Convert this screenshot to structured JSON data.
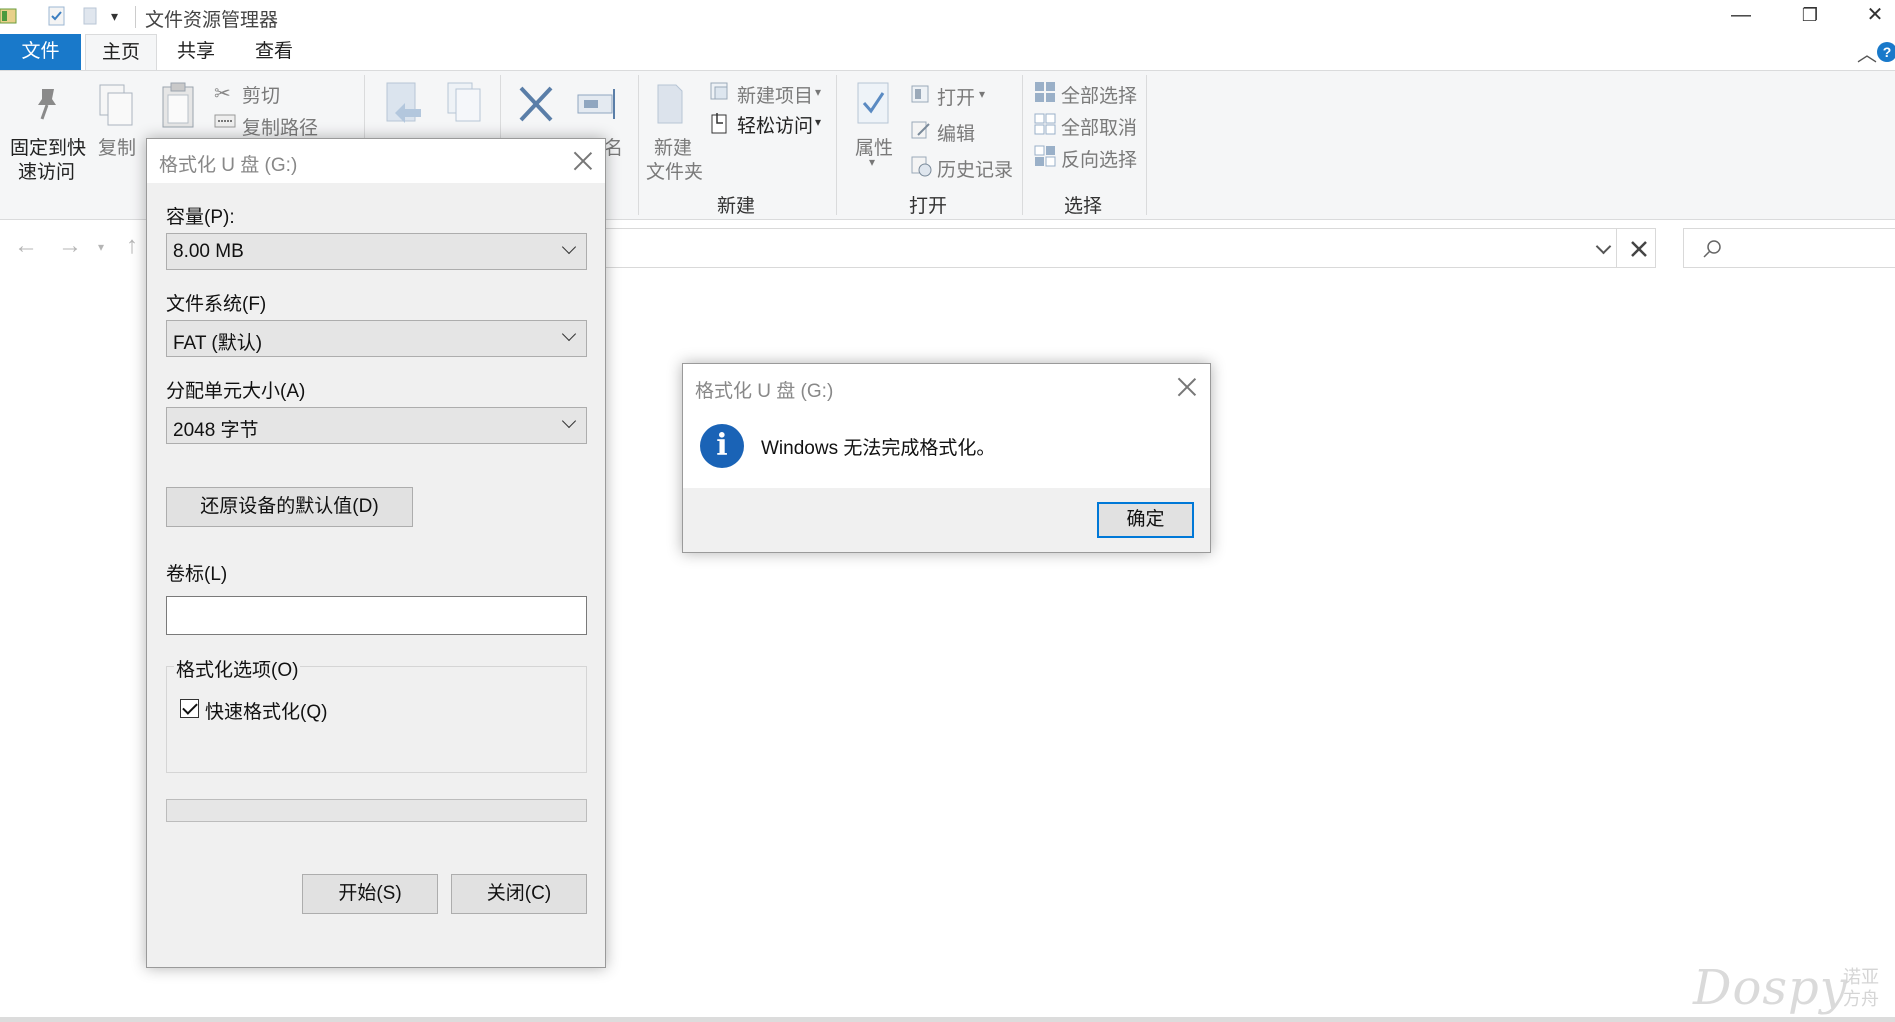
{
  "window": {
    "title": "文件资源管理器",
    "minimize_glyph": "—",
    "restore_glyph": "❐",
    "close_glyph": "✕"
  },
  "tabs": [
    {
      "label": "文件"
    },
    {
      "label": "主页"
    },
    {
      "label": "共享"
    },
    {
      "label": "查看"
    }
  ],
  "ribbon": {
    "pin_label_1": "固定到快",
    "pin_label_2": "速访问",
    "copy_label": "复制",
    "cut_label": "剪切",
    "copy_path_label": "复制路径",
    "rename_fragment": "名",
    "new_folder_label_1": "新建",
    "new_folder_label_2": "文件夹",
    "new_item_label": "新建项目",
    "easy_access_label": "轻松访问",
    "properties_label": "属性",
    "open_label": "打开",
    "edit_label": "编辑",
    "history_label": "历史记录",
    "select_all_label": "全部选择",
    "select_none_label": "全部取消",
    "invert_selection_label": "反向选择",
    "group_new": "新建",
    "group_open": "打开",
    "group_select": "选择"
  },
  "format_dialog": {
    "title": "格式化 U 盘 (G:)",
    "capacity_label": "容量(P):",
    "capacity_value": "8.00 MB",
    "filesystem_label": "文件系统(F)",
    "filesystem_value": "FAT (默认)",
    "allocation_label": "分配单元大小(A)",
    "allocation_value": "2048 字节",
    "restore_defaults_button": "还原设备的默认值(D)",
    "volume_label": "卷标(L)",
    "volume_value": "",
    "options_group_label": "格式化选项(O)",
    "quick_format_label": "快速格式化(Q)",
    "quick_format_checked": true,
    "progress": 0,
    "start_button": "开始(S)",
    "close_button": "关闭(C)"
  },
  "message_box": {
    "title": "格式化 U 盘 (G:)",
    "message": "Windows 无法完成格式化。",
    "icon": "info-icon",
    "ok_button": "确定"
  },
  "watermark": {
    "brand": "Dospy",
    "brand_cn_1": "诺亚",
    "brand_cn_2": "方舟"
  },
  "colors": {
    "file_tab": "#1979ca",
    "info_icon": "#1a63b6",
    "ok_button_border": "#0078d7"
  }
}
